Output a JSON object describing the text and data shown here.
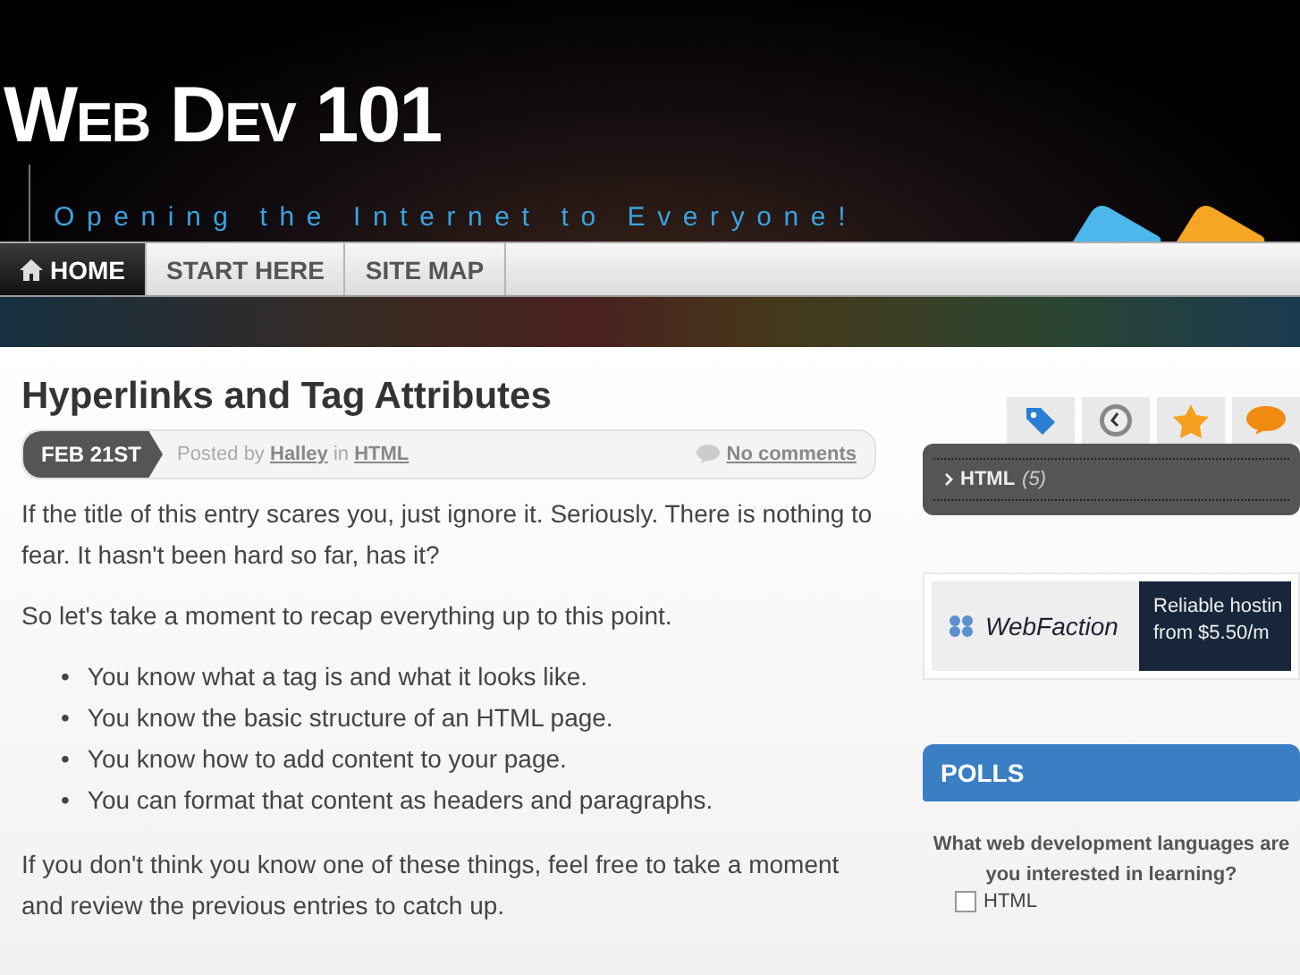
{
  "header": {
    "title_big_1": "W",
    "title_small_1": "EB",
    "title_big_2": "D",
    "title_small_2": "EV",
    "title_number": "101",
    "tagline": "Opening the Internet to Everyone!"
  },
  "nav": [
    {
      "label": "HOME",
      "selected": true,
      "kind": "home"
    },
    {
      "label": "START HERE",
      "selected": false,
      "kind": "plain"
    },
    {
      "label": "SITE MAP",
      "selected": false,
      "kind": "plain"
    }
  ],
  "post": {
    "title": "Hyperlinks and Tag Attributes",
    "date": "FEB 21ST",
    "posted_by": "Posted by",
    "author": "Halley",
    "in": "in",
    "category": "HTML",
    "comments": "No comments",
    "paragraphs_before": [
      "If the title of this entry scares you, just ignore it. Seriously. There is nothing to fear. It hasn't been hard so far, has it?",
      "So let's take a moment to recap everything up to this point."
    ],
    "bullets": [
      {
        "marker": "•",
        "text": "You know what a tag is and what it looks like."
      },
      {
        "marker": "•",
        "text": "You know the basic structure of an HTML page."
      },
      {
        "marker": "•",
        "text": "You know how to add content to your page."
      },
      {
        "marker": "•",
        "text": "You can format that content as headers and paragraphs."
      }
    ],
    "paragraphs_after": [
      "If you don't think you know one of these things, feel free to take a moment and review the previous entries to catch up."
    ]
  },
  "sidebar": {
    "tabs": [
      {
        "kind": "tag"
      },
      {
        "kind": "clock"
      },
      {
        "kind": "star"
      },
      {
        "kind": "comment"
      }
    ],
    "categories": [
      {
        "name": "HTML",
        "count": "(5)"
      }
    ],
    "ad": {
      "brand": "WebFaction",
      "line_1": "Reliable hostin",
      "line_2": "from $5.50/m"
    },
    "polls": {
      "title": "POLLS",
      "question": "What web development languages are you interested in learning?",
      "options": [
        {
          "label": "HTML",
          "checked": false
        }
      ]
    }
  }
}
